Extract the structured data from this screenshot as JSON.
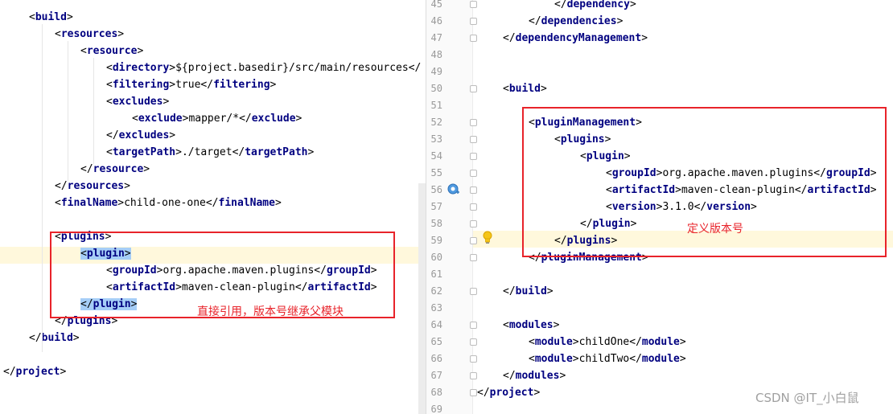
{
  "left": {
    "lines": [
      {
        "indent": 1,
        "parts": [
          [
            "b",
            "<"
          ],
          [
            "t",
            "build"
          ],
          [
            "b",
            ">"
          ]
        ]
      },
      {
        "indent": 2,
        "parts": [
          [
            "b",
            "<"
          ],
          [
            "t",
            "resources"
          ],
          [
            "b",
            ">"
          ]
        ]
      },
      {
        "indent": 3,
        "parts": [
          [
            "b",
            "<"
          ],
          [
            "t",
            "resource"
          ],
          [
            "b",
            ">"
          ]
        ]
      },
      {
        "indent": 4,
        "parts": [
          [
            "b",
            "<"
          ],
          [
            "t",
            "directory"
          ],
          [
            "b",
            ">"
          ],
          [
            "x",
            "${project.basedir}/src/main/resources"
          ],
          [
            "b",
            "</"
          ]
        ]
      },
      {
        "indent": 4,
        "parts": [
          [
            "b",
            "<"
          ],
          [
            "t",
            "filtering"
          ],
          [
            "b",
            ">"
          ],
          [
            "x",
            "true"
          ],
          [
            "b",
            "</"
          ],
          [
            "t",
            "filtering"
          ],
          [
            "b",
            ">"
          ]
        ]
      },
      {
        "indent": 4,
        "parts": [
          [
            "b",
            "<"
          ],
          [
            "t",
            "excludes"
          ],
          [
            "b",
            ">"
          ]
        ]
      },
      {
        "indent": 5,
        "parts": [
          [
            "b",
            "<"
          ],
          [
            "t",
            "exclude"
          ],
          [
            "b",
            ">"
          ],
          [
            "x",
            "mapper/*"
          ],
          [
            "b",
            "</"
          ],
          [
            "t",
            "exclude"
          ],
          [
            "b",
            ">"
          ]
        ]
      },
      {
        "indent": 4,
        "parts": [
          [
            "b",
            "</"
          ],
          [
            "t",
            "excludes"
          ],
          [
            "b",
            ">"
          ]
        ]
      },
      {
        "indent": 4,
        "parts": [
          [
            "b",
            "<"
          ],
          [
            "t",
            "targetPath"
          ],
          [
            "b",
            ">"
          ],
          [
            "x",
            "./target"
          ],
          [
            "b",
            "</"
          ],
          [
            "t",
            "targetPath"
          ],
          [
            "b",
            ">"
          ]
        ]
      },
      {
        "indent": 3,
        "parts": [
          [
            "b",
            "</"
          ],
          [
            "t",
            "resource"
          ],
          [
            "b",
            ">"
          ]
        ]
      },
      {
        "indent": 2,
        "parts": [
          [
            "b",
            "</"
          ],
          [
            "t",
            "resources"
          ],
          [
            "b",
            ">"
          ]
        ]
      },
      {
        "indent": 2,
        "parts": [
          [
            "b",
            "<"
          ],
          [
            "t",
            "finalName"
          ],
          [
            "b",
            ">"
          ],
          [
            "x",
            "child-one-one"
          ],
          [
            "b",
            "</"
          ],
          [
            "t",
            "finalName"
          ],
          [
            "b",
            ">"
          ]
        ]
      },
      {
        "indent": 0,
        "parts": []
      },
      {
        "indent": 2,
        "parts": [
          [
            "b",
            "<"
          ],
          [
            "t",
            "plugins"
          ],
          [
            "b",
            ">"
          ]
        ]
      },
      {
        "indent": 3,
        "parts": [
          [
            "b",
            "<"
          ],
          [
            "t",
            "plugin"
          ],
          [
            "b",
            ">"
          ]
        ],
        "selected": true,
        "current": true
      },
      {
        "indent": 4,
        "parts": [
          [
            "b",
            "<"
          ],
          [
            "t",
            "groupId"
          ],
          [
            "b",
            ">"
          ],
          [
            "x",
            "org.apache.maven.plugins"
          ],
          [
            "b",
            "</"
          ],
          [
            "t",
            "groupId"
          ],
          [
            "b",
            ">"
          ]
        ]
      },
      {
        "indent": 4,
        "parts": [
          [
            "b",
            "<"
          ],
          [
            "t",
            "artifactId"
          ],
          [
            "b",
            ">"
          ],
          [
            "x",
            "maven-clean-plugin"
          ],
          [
            "b",
            "</"
          ],
          [
            "t",
            "artifactId"
          ],
          [
            "b",
            ">"
          ]
        ]
      },
      {
        "indent": 3,
        "parts": [
          [
            "b",
            "</"
          ],
          [
            "t",
            "plugin"
          ],
          [
            "b",
            ">"
          ]
        ],
        "selected": true
      },
      {
        "indent": 2,
        "parts": [
          [
            "b",
            "</"
          ],
          [
            "t",
            "plugins"
          ],
          [
            "b",
            ">"
          ]
        ]
      },
      {
        "indent": 1,
        "parts": [
          [
            "b",
            "</"
          ],
          [
            "t",
            "build"
          ],
          [
            "b",
            ">"
          ]
        ]
      },
      {
        "indent": 0,
        "parts": []
      },
      {
        "indent": 0,
        "parts": [
          [
            "b",
            "</"
          ],
          [
            "t",
            "project"
          ],
          [
            "b",
            ">"
          ]
        ]
      }
    ],
    "annotation": "直接引用，版本号继承父模块"
  },
  "right": {
    "lines": [
      {
        "n": "45",
        "indent": 3,
        "parts": [
          [
            "b",
            "</"
          ],
          [
            "t",
            "dependency"
          ],
          [
            "b",
            ">"
          ]
        ]
      },
      {
        "n": "46",
        "indent": 2,
        "parts": [
          [
            "b",
            "</"
          ],
          [
            "t",
            "dependencies"
          ],
          [
            "b",
            ">"
          ]
        ]
      },
      {
        "n": "47",
        "indent": 1,
        "parts": [
          [
            "b",
            "</"
          ],
          [
            "t",
            "dependencyManagement"
          ],
          [
            "b",
            ">"
          ]
        ]
      },
      {
        "n": "48",
        "indent": 0,
        "parts": []
      },
      {
        "n": "49",
        "indent": 0,
        "parts": []
      },
      {
        "n": "50",
        "indent": 1,
        "parts": [
          [
            "b",
            "<"
          ],
          [
            "t",
            "build"
          ],
          [
            "b",
            ">"
          ]
        ]
      },
      {
        "n": "51",
        "indent": 0,
        "parts": []
      },
      {
        "n": "52",
        "indent": 2,
        "parts": [
          [
            "b",
            "<"
          ],
          [
            "t",
            "pluginManagement"
          ],
          [
            "b",
            ">"
          ]
        ]
      },
      {
        "n": "53",
        "indent": 3,
        "parts": [
          [
            "b",
            "<"
          ],
          [
            "t",
            "plugins"
          ],
          [
            "b",
            ">"
          ]
        ]
      },
      {
        "n": "54",
        "indent": 4,
        "parts": [
          [
            "b",
            "<"
          ],
          [
            "t",
            "plugin"
          ],
          [
            "b",
            ">"
          ]
        ]
      },
      {
        "n": "55",
        "indent": 5,
        "parts": [
          [
            "b",
            "<"
          ],
          [
            "t",
            "groupId"
          ],
          [
            "b",
            ">"
          ],
          [
            "x",
            "org.apache.maven.plugins"
          ],
          [
            "b",
            "</"
          ],
          [
            "t",
            "groupId"
          ],
          [
            "b",
            ">"
          ]
        ]
      },
      {
        "n": "56",
        "indent": 5,
        "parts": [
          [
            "b",
            "<"
          ],
          [
            "t",
            "artifactId"
          ],
          [
            "b",
            ">"
          ],
          [
            "x",
            "maven-clean-plugin"
          ],
          [
            "b",
            "</"
          ],
          [
            "t",
            "artifactId"
          ],
          [
            "b",
            ">"
          ]
        ]
      },
      {
        "n": "57",
        "indent": 5,
        "parts": [
          [
            "b",
            "<"
          ],
          [
            "t",
            "version"
          ],
          [
            "b",
            ">"
          ],
          [
            "x",
            "3.1.0"
          ],
          [
            "b",
            "</"
          ],
          [
            "t",
            "version"
          ],
          [
            "b",
            ">"
          ]
        ]
      },
      {
        "n": "58",
        "indent": 4,
        "parts": [
          [
            "b",
            "</"
          ],
          [
            "t",
            "plugin"
          ],
          [
            "b",
            ">"
          ]
        ]
      },
      {
        "n": "59",
        "indent": 3,
        "parts": [
          [
            "b",
            "</"
          ],
          [
            "t",
            "plugins"
          ],
          [
            "b",
            ">"
          ]
        ],
        "current": true
      },
      {
        "n": "60",
        "indent": 2,
        "parts": [
          [
            "b",
            "</"
          ],
          [
            "t",
            "pluginManagement"
          ],
          [
            "b",
            ">"
          ]
        ]
      },
      {
        "n": "61",
        "indent": 0,
        "parts": []
      },
      {
        "n": "62",
        "indent": 1,
        "parts": [
          [
            "b",
            "</"
          ],
          [
            "t",
            "build"
          ],
          [
            "b",
            ">"
          ]
        ]
      },
      {
        "n": "63",
        "indent": 0,
        "parts": []
      },
      {
        "n": "64",
        "indent": 1,
        "parts": [
          [
            "b",
            "<"
          ],
          [
            "t",
            "modules"
          ],
          [
            "b",
            ">"
          ]
        ]
      },
      {
        "n": "65",
        "indent": 2,
        "parts": [
          [
            "b",
            "<"
          ],
          [
            "t",
            "module"
          ],
          [
            "b",
            ">"
          ],
          [
            "x",
            "childOne"
          ],
          [
            "b",
            "</"
          ],
          [
            "t",
            "module"
          ],
          [
            "b",
            ">"
          ]
        ]
      },
      {
        "n": "66",
        "indent": 2,
        "parts": [
          [
            "b",
            "<"
          ],
          [
            "t",
            "module"
          ],
          [
            "b",
            ">"
          ],
          [
            "x",
            "childTwo"
          ],
          [
            "b",
            "</"
          ],
          [
            "t",
            "module"
          ],
          [
            "b",
            ">"
          ]
        ]
      },
      {
        "n": "67",
        "indent": 1,
        "parts": [
          [
            "b",
            "</"
          ],
          [
            "t",
            "modules"
          ],
          [
            "b",
            ">"
          ]
        ]
      },
      {
        "n": "68",
        "indent": 0,
        "parts": [
          [
            "b",
            "</"
          ],
          [
            "t",
            "project"
          ],
          [
            "b",
            ">"
          ]
        ]
      },
      {
        "n": "69",
        "indent": 0,
        "parts": []
      }
    ],
    "annotation": "定义版本号"
  },
  "watermark": "CSDN @IT_小白鼠",
  "icons": {
    "gutter_run": "maven-goal-icon",
    "bulb": "lightbulb-icon"
  },
  "colors": {
    "tag": "#000080",
    "highlight_box": "#e8232a",
    "selection": "#a6cef7",
    "current_line": "#fff8dc"
  }
}
